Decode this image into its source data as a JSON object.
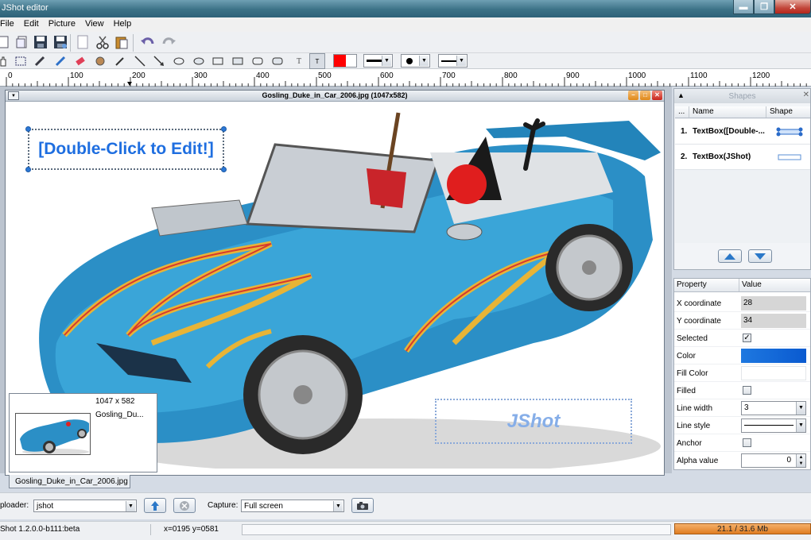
{
  "window": {
    "title": "JShot editor"
  },
  "menu": [
    "File",
    "Edit",
    "Picture",
    "View",
    "Help"
  ],
  "colors": {
    "primary": "#ff0000",
    "secondary": "#ffffff",
    "accent": "#1e6ee0"
  },
  "ruler": {
    "labels": [
      "0",
      "100",
      "200",
      "300",
      "400",
      "500",
      "600",
      "700",
      "800",
      "900",
      "1000",
      "1100",
      "1200"
    ]
  },
  "image_window": {
    "title": "Gosling_Duke_in_Car_2006.jpg (1047x582)",
    "textbox_edit": "[Double-Click to Edit!]",
    "textbox_jshot": "JShot"
  },
  "thumbnail": {
    "size": "1047 x 582",
    "name": "Gosling_Du..."
  },
  "doc_tab": "Gosling_Duke_in_Car_2006.jpg",
  "shapes": {
    "title": "Shapes",
    "columns": [
      "...",
      "Name",
      "Shape"
    ],
    "rows": [
      {
        "num": "1.",
        "name": "TextBox([Double-..."
      },
      {
        "num": "2.",
        "name": "TextBox(JShot)"
      }
    ]
  },
  "properties": {
    "columns": [
      "Property",
      "Value"
    ],
    "rows": [
      {
        "key": "X coordinate",
        "value": "28"
      },
      {
        "key": "Y coordinate",
        "value": "34"
      },
      {
        "key": "Selected",
        "value": "✓"
      },
      {
        "key": "Color",
        "value": "#1e78e0"
      },
      {
        "key": "Fill Color",
        "value": ""
      },
      {
        "key": "Filled",
        "value": ""
      },
      {
        "key": "Line width",
        "value": "3"
      },
      {
        "key": "Line style",
        "value": ""
      },
      {
        "key": "Anchor",
        "value": ""
      },
      {
        "key": "Alpha value",
        "value": "0"
      }
    ]
  },
  "uploader": {
    "label": "ploader:",
    "value": "jshot",
    "capture_label": "Capture:",
    "capture_value": "Full screen"
  },
  "status": {
    "version": "Shot 1.2.0.0-b111:beta",
    "coords": "x=0195 y=0581",
    "memory": "21.1 / 31.6 Mb"
  }
}
